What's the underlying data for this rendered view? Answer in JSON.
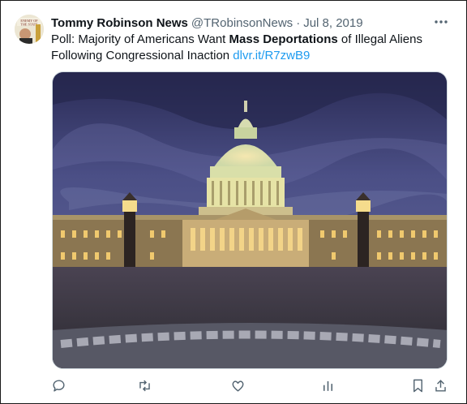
{
  "tweet": {
    "author_name": "Tommy Robinson News",
    "handle": "@TRobinsonNews",
    "separator": "·",
    "date": "Jul 8, 2019",
    "text_before": "Poll: Majority of Americans Want ",
    "text_bold": "Mass Deportations",
    "text_after": " of Illegal Aliens Following Congressional Inaction ",
    "link": "dlvr.it/R7zwB9",
    "more_icon": "ellipsis-icon",
    "avatar_text": "ENEMY OF THE STATE",
    "media_description_icon": "us-capitol-photo"
  },
  "actions": [
    {
      "name": "reply-icon"
    },
    {
      "name": "retweet-icon"
    },
    {
      "name": "like-icon"
    },
    {
      "name": "views-icon"
    },
    {
      "name": "bookmark-icon"
    },
    {
      "name": "share-icon"
    }
  ],
  "colors": {
    "text": "#0f1419",
    "secondary": "#536471",
    "link": "#1d9bf0"
  }
}
